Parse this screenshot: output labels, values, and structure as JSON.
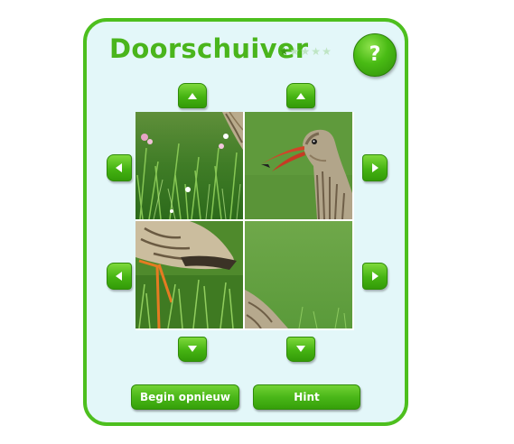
{
  "game": {
    "title": "Doorschuiver",
    "difficulty_level": 1,
    "difficulty_max": 5,
    "help_label": "?",
    "restart_label": "Begin opnieuw",
    "hint_label": "Hint"
  },
  "board": {
    "rows": 2,
    "cols": 2,
    "tiles": [
      {
        "row": 1,
        "col": 1,
        "content": "grass with flowers and bird back edge"
      },
      {
        "row": 1,
        "col": 2,
        "content": "redshank head with open beak"
      },
      {
        "row": 2,
        "col": 1,
        "content": "bird wing and orange legs in grass"
      },
      {
        "row": 2,
        "col": 2,
        "content": "green background with bird back corner"
      }
    ]
  },
  "colors": {
    "accent": "#4dbf1e",
    "panel_background": "#e3f7f9",
    "button_green": "#45b312"
  }
}
